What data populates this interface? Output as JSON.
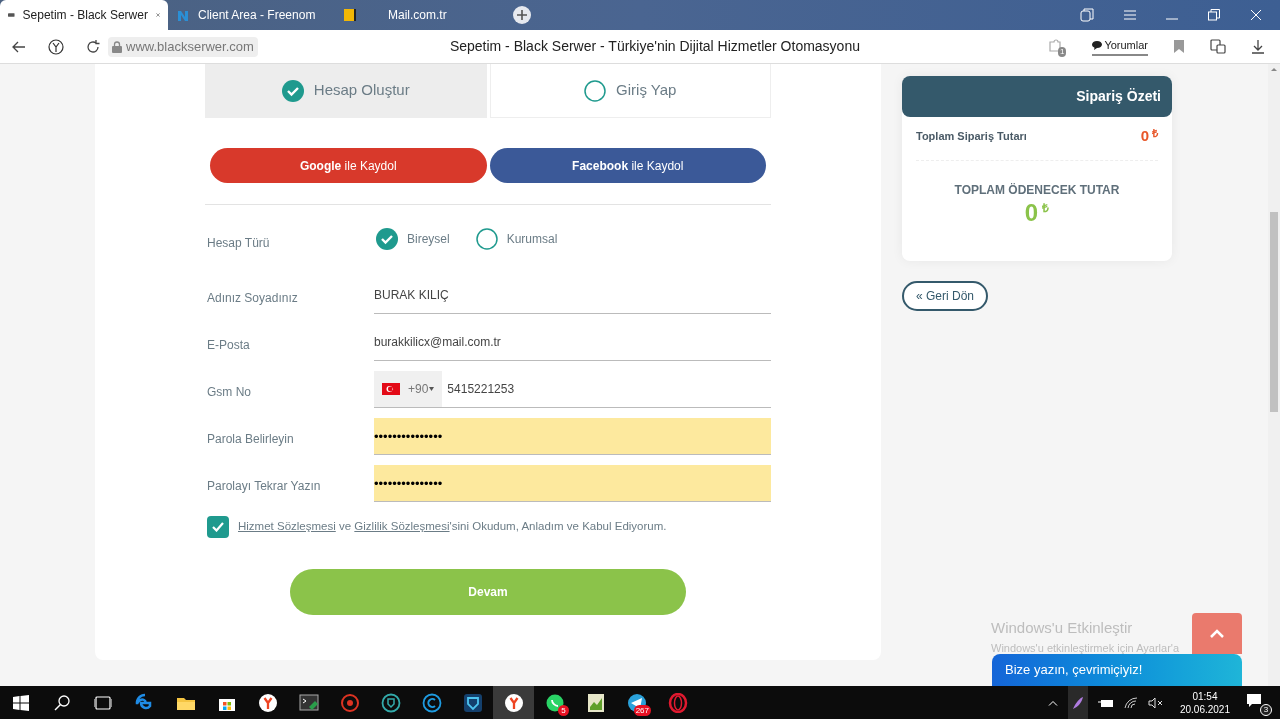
{
  "browser": {
    "tabs": [
      {
        "title": "Sepetim - Black Serwer",
        "selected": true,
        "kind": "site"
      },
      {
        "title": "Client Area - Freenom",
        "selected": false,
        "kind": "freenom"
      },
      {
        "title": "Mail.com.tr",
        "selected": false,
        "kind": "mail"
      }
    ],
    "address": "www.blackserwer.com",
    "page_title": "Sepetim - Black Serwer - Türkiye'nin Dijital Hizmetler Otomasyonu",
    "comments_label": "Yorumlar",
    "extension_badge": "1"
  },
  "form": {
    "mode_tabs": [
      {
        "label": "Hesap Oluştur",
        "selected": true
      },
      {
        "label": "Giriş Yap",
        "selected": false
      }
    ],
    "social_buttons": [
      {
        "kind": "google",
        "label": "**Google** ile Kaydol"
      },
      {
        "kind": "facebook",
        "label": "**Facebook** ile Kaydol"
      }
    ],
    "account_type": {
      "label": "Hesap Türü",
      "options": [
        {
          "label": "Bireysel",
          "selected": true
        },
        {
          "label": "Kurumsal",
          "selected": false
        }
      ]
    },
    "fields": [
      {
        "kind": "text",
        "label": "Adınız Soyadınız",
        "value": "BURAK KILIÇ"
      },
      {
        "kind": "text",
        "label": "E-Posta",
        "value": "burakkilicx@mail.com.tr"
      },
      {
        "kind": "phone",
        "label": "Gsm No",
        "dial_code": "+90",
        "value": "5415221253"
      },
      {
        "kind": "password",
        "label": "Parola Belirleyin",
        "value": "•••••••••••••••"
      },
      {
        "kind": "password",
        "label": "Parolayı Tekrar Yazın",
        "value": "•••••••••••••••"
      }
    ],
    "agreement": {
      "checked": true,
      "link_1": "Hizmet Sözleşmesi",
      "text_1": " ve ",
      "link_2": "Gizlilik Sözleşmesi",
      "text_2": "'sini Okudum, Anladım ve Kabul Ediyorum."
    },
    "submit": "Devam"
  },
  "order_summary": {
    "title": "Sipariş Özeti",
    "total_label": "Toplam Sipariş Tutarı",
    "total_value": "0",
    "currency": "₺",
    "payable_label": "TOPLAM ÖDENECEK TUTAR",
    "payable_value": "0",
    "payable_currency": "₺"
  },
  "back_button": "« Geri Dön",
  "chat_widget": "Bize yazın, çevrimiçiyiz!",
  "activation_notice": {
    "title": "Windows'u Etkinleştir",
    "text": "Windows'u etkinleştirmek için Ayarlar'a"
  },
  "taskbar": {
    "apps": [
      {
        "kind": "edge",
        "active": false
      },
      {
        "kind": "folder",
        "active": false
      },
      {
        "kind": "store",
        "active": false
      },
      {
        "kind": "yandex",
        "active": false
      },
      {
        "kind": "terminal",
        "active": false
      },
      {
        "kind": "red",
        "active": false
      },
      {
        "kind": "teal",
        "active": false
      },
      {
        "kind": "blue",
        "active": false
      },
      {
        "kind": "shield",
        "active": false
      },
      {
        "kind": "yandex",
        "active": true
      },
      {
        "kind": "whatsapp",
        "active": false,
        "badge": "5"
      },
      {
        "kind": "notepad",
        "active": false
      },
      {
        "kind": "telegram",
        "active": false,
        "badge": "267"
      },
      {
        "kind": "opera",
        "active": false
      }
    ],
    "time": "01:54",
    "date": "20.06.2021",
    "notifications": "3"
  }
}
